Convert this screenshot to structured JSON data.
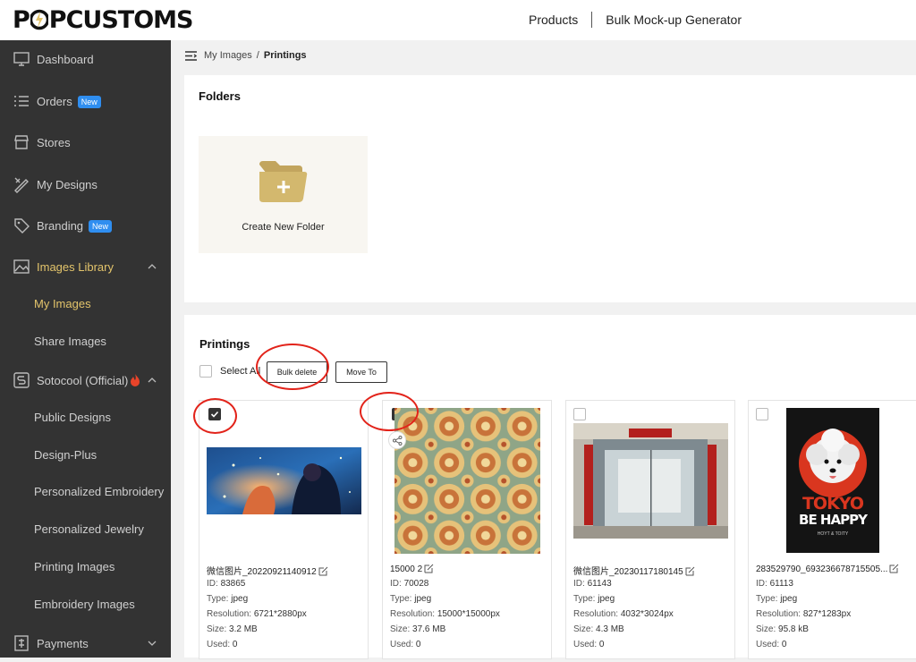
{
  "app": {
    "brand": "POPCUSTOMS"
  },
  "topnav": {
    "products": "Products",
    "bulk_mockup": "Bulk Mock-up Generator"
  },
  "sidebar": {
    "dashboard": "Dashboard",
    "orders": "Orders",
    "orders_badge": "New",
    "stores": "Stores",
    "my_designs": "My Designs",
    "branding": "Branding",
    "branding_badge": "New",
    "images_library": "Images Library",
    "my_images": "My Images",
    "share_images": "Share Images",
    "sotocool": "Sotocool (Official)",
    "public_designs": "Public Designs",
    "design_plus": "Design-Plus",
    "personalized_embroidery": "Personalized Embroidery",
    "personalized_jewelry": "Personalized Jewelry",
    "printing_images": "Printing Images",
    "embroidery_images": "Embroidery Images",
    "payments": "Payments"
  },
  "breadcrumb": {
    "root": "My Images",
    "current": "Printings"
  },
  "folders": {
    "title": "Folders",
    "create_label": "Create New Folder"
  },
  "printings": {
    "title": "Printings",
    "select_all": "Select All",
    "bulk_delete": "Bulk delete",
    "move_to": "Move To"
  },
  "labels": {
    "id": "ID:",
    "type": "Type:",
    "resolution": "Resolution:",
    "size": "Size:",
    "used": "Used:"
  },
  "images": [
    {
      "name": "微信图片_20220921140912",
      "id": "83865",
      "type": "jpeg",
      "resolution": "6721*2880px",
      "size": "3.2 MB",
      "used": "0",
      "checked": true
    },
    {
      "name": "15000 2",
      "id": "70028",
      "type": "jpeg",
      "resolution": "15000*15000px",
      "size": "37.6 MB",
      "used": "0",
      "checked": true
    },
    {
      "name": "微信图片_20230117180145",
      "id": "61143",
      "type": "jpeg",
      "resolution": "4032*3024px",
      "size": "4.3 MB",
      "used": "0",
      "checked": false
    },
    {
      "name": "283529790_693236678715505...",
      "id": "61113",
      "type": "jpeg",
      "resolution": "827*1283px",
      "size": "95.8 kB",
      "used": "0",
      "checked": false
    }
  ],
  "poster": {
    "line1": "TOKYO",
    "line2": "BE HAPPY",
    "line3": "HOYT & TOITY"
  },
  "colors": {
    "accent": "#e3c46b",
    "sidebar_bg": "#333333",
    "badge": "#2f8ef0",
    "annotation": "#e2231a"
  }
}
